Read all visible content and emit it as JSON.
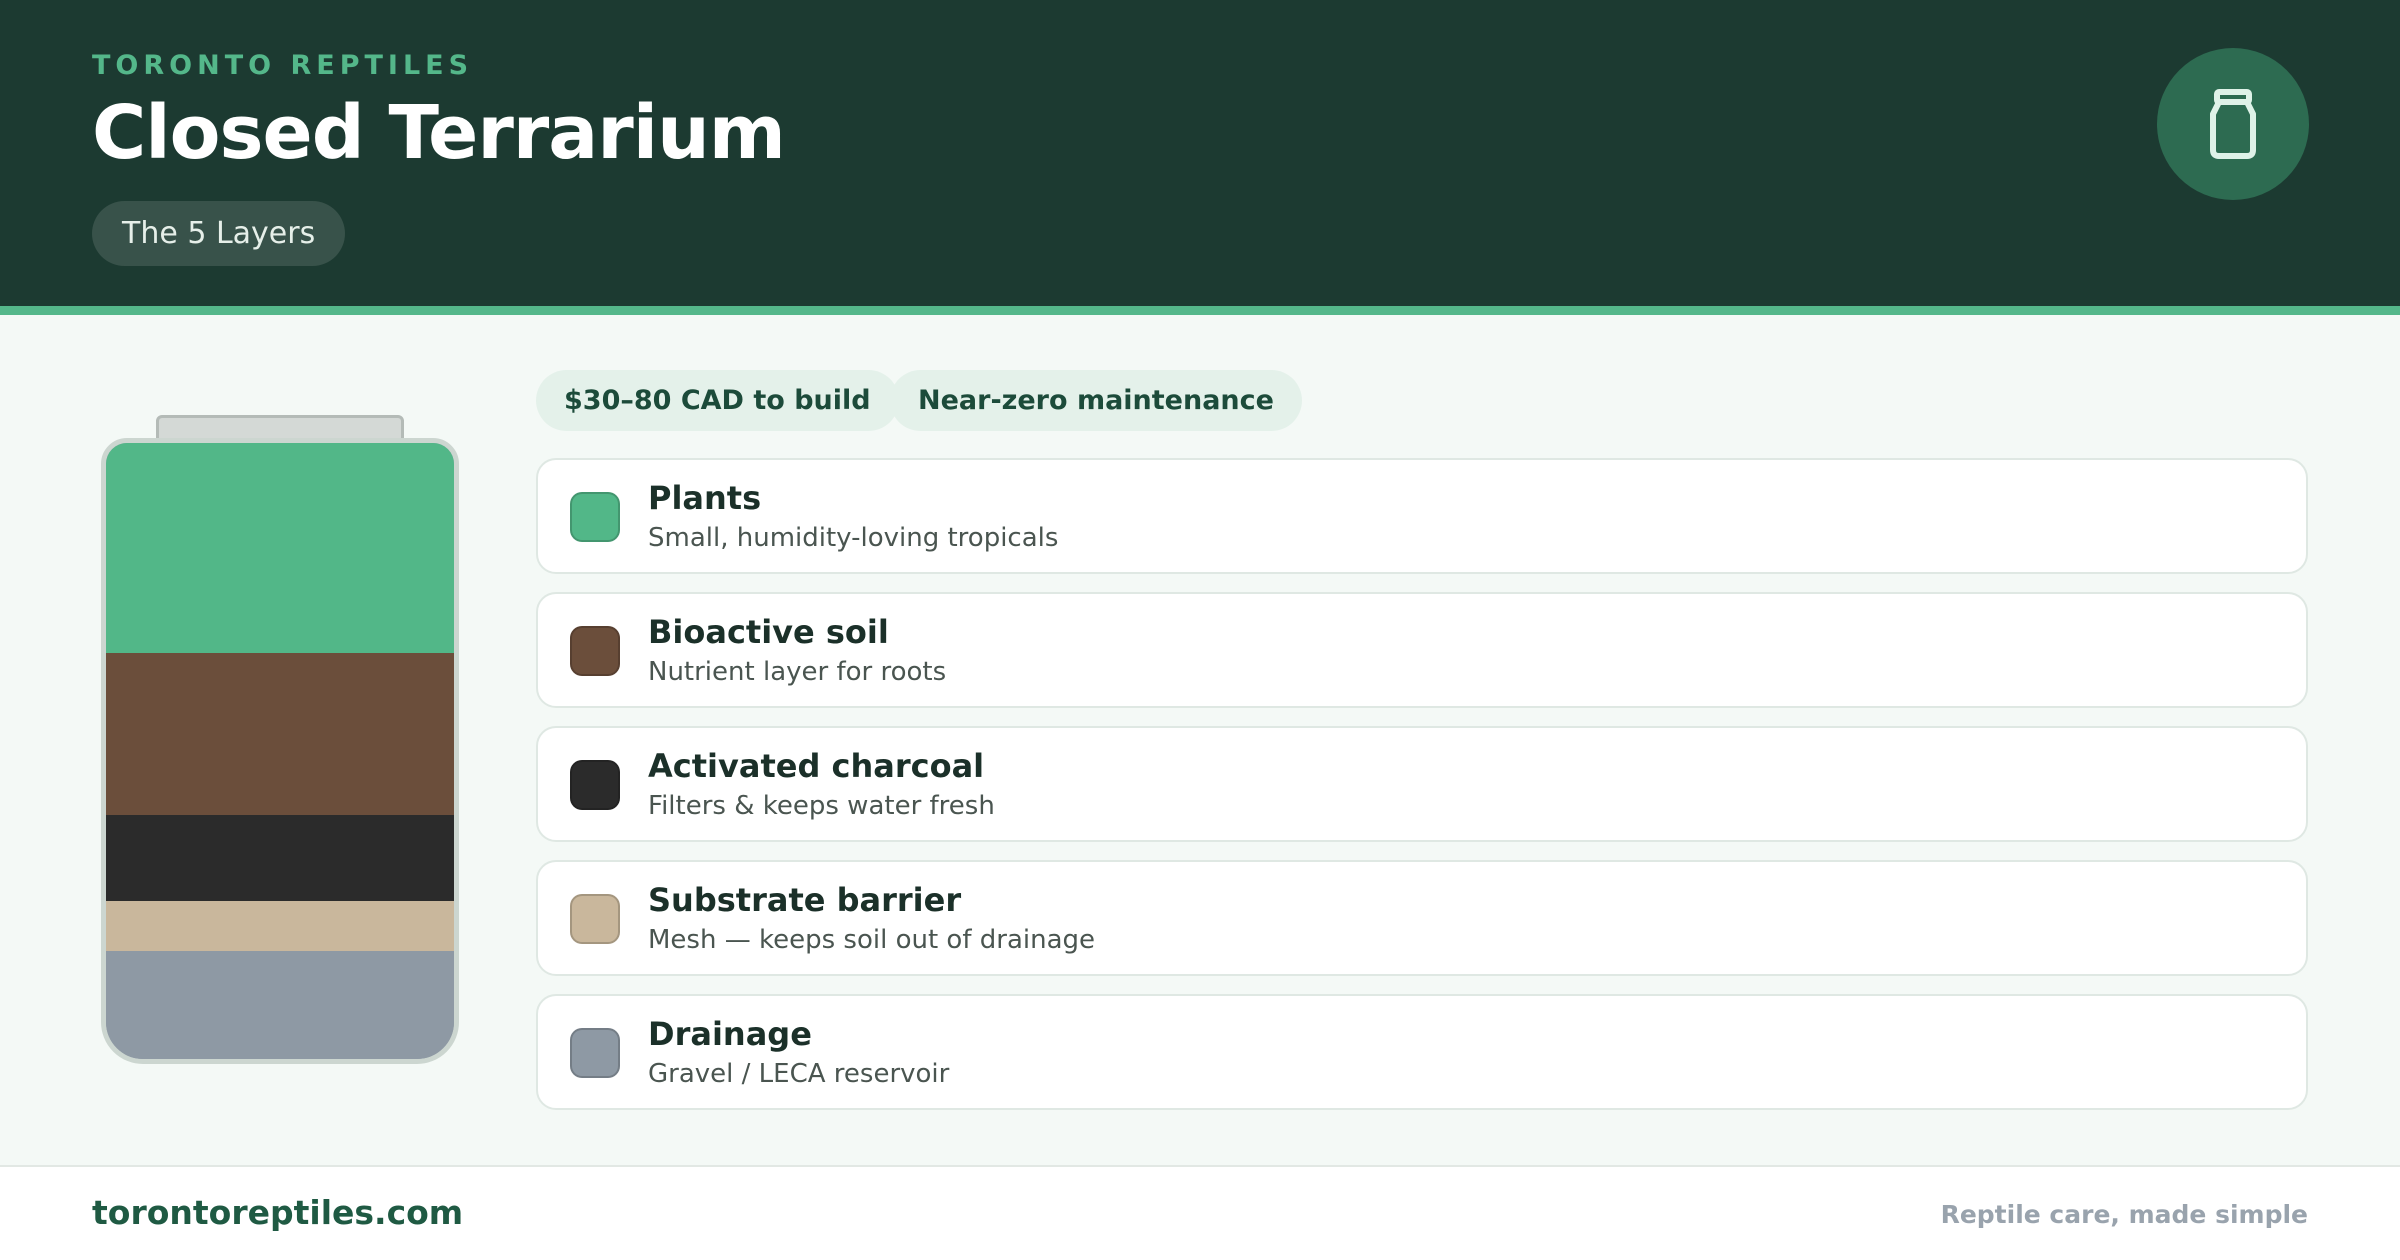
{
  "header": {
    "brand": "TORONTO REPTILES",
    "title": "Closed Terrarium",
    "subtitle": "The 5 Layers",
    "icon": "jar-icon"
  },
  "tags": [
    {
      "label": "$30–80 CAD to build"
    },
    {
      "label": "Near-zero maintenance"
    }
  ],
  "layers": [
    {
      "title": "Plants",
      "description": "Small, humidity-loving tropicals",
      "color": "#52b788"
    },
    {
      "title": "Bioactive soil",
      "description": "Nutrient layer for roots",
      "color": "#6b4e3b"
    },
    {
      "title": "Activated charcoal",
      "description": "Filters & keeps water fresh",
      "color": "#2b2b2b"
    },
    {
      "title": "Substrate barrier",
      "description": "Mesh — keeps soil out of drainage",
      "color": "#c9b79c"
    },
    {
      "title": "Drainage",
      "description": "Gravel / LECA reservoir",
      "color": "#8e99a4"
    }
  ],
  "footer": {
    "site": "torontoreptiles.com",
    "tagline": "Reptile care, made simple"
  }
}
